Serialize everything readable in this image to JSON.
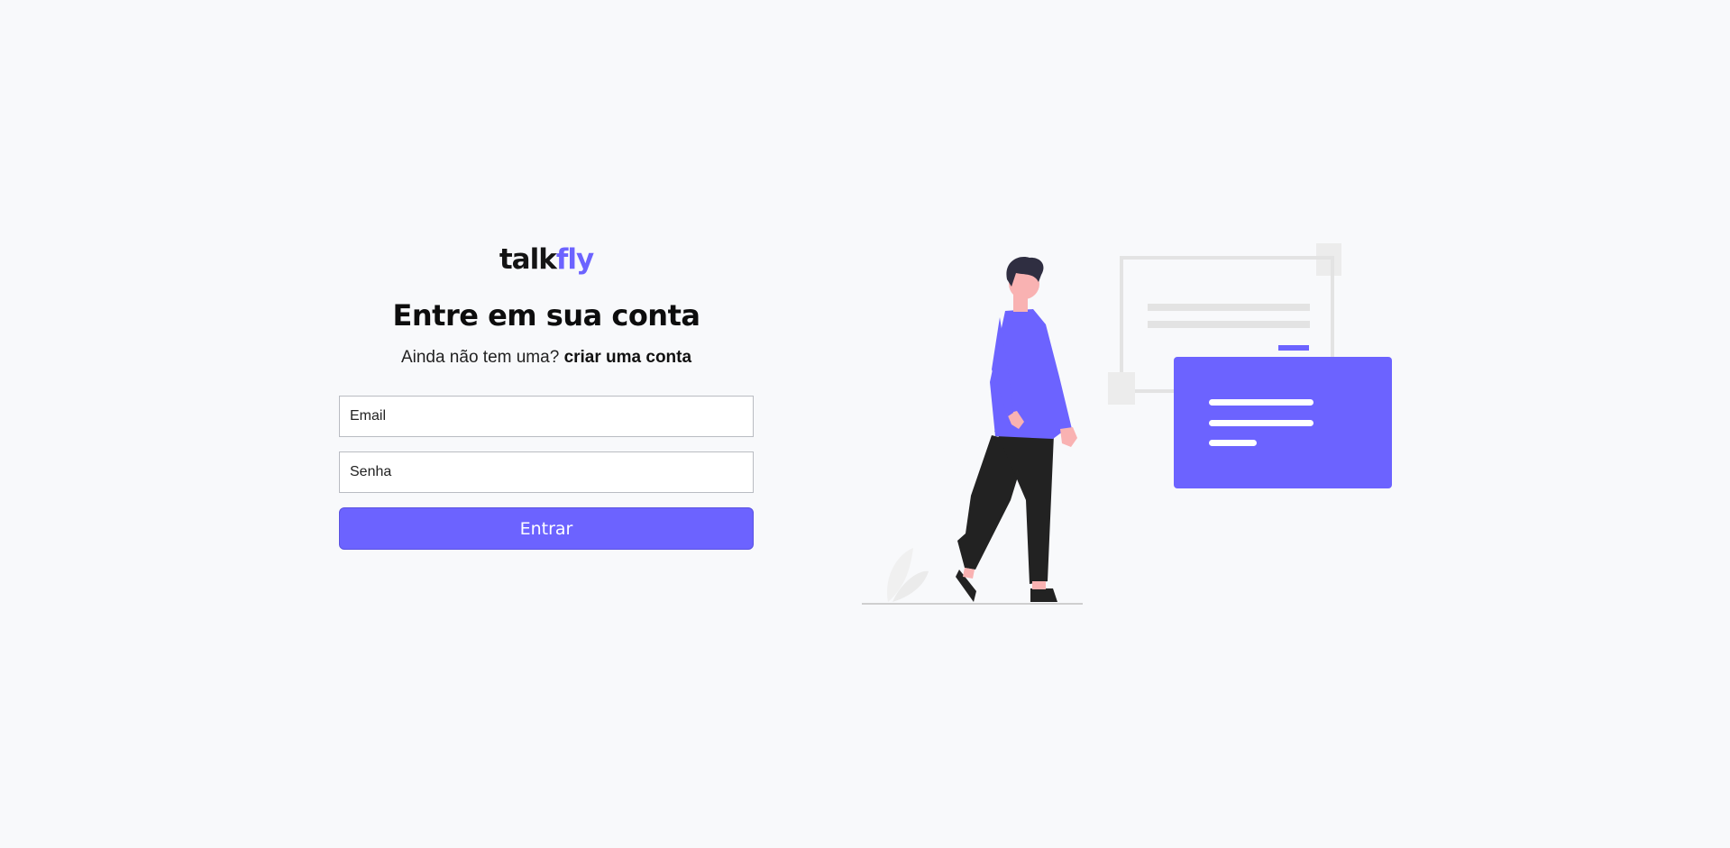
{
  "brand": {
    "part1": "talk",
    "part2": "fly"
  },
  "heading": "Entre em sua conta",
  "subtitle": {
    "text": "Ainda não tem uma? ",
    "link": "criar uma conta"
  },
  "form": {
    "email_placeholder": "Email",
    "password_placeholder": "Senha",
    "submit_label": "Entrar"
  },
  "colors": {
    "accent": "#6c63ff",
    "background": "#f8f9fb"
  },
  "icons": {
    "illustration": "person-walking-with-documents-illustration"
  }
}
